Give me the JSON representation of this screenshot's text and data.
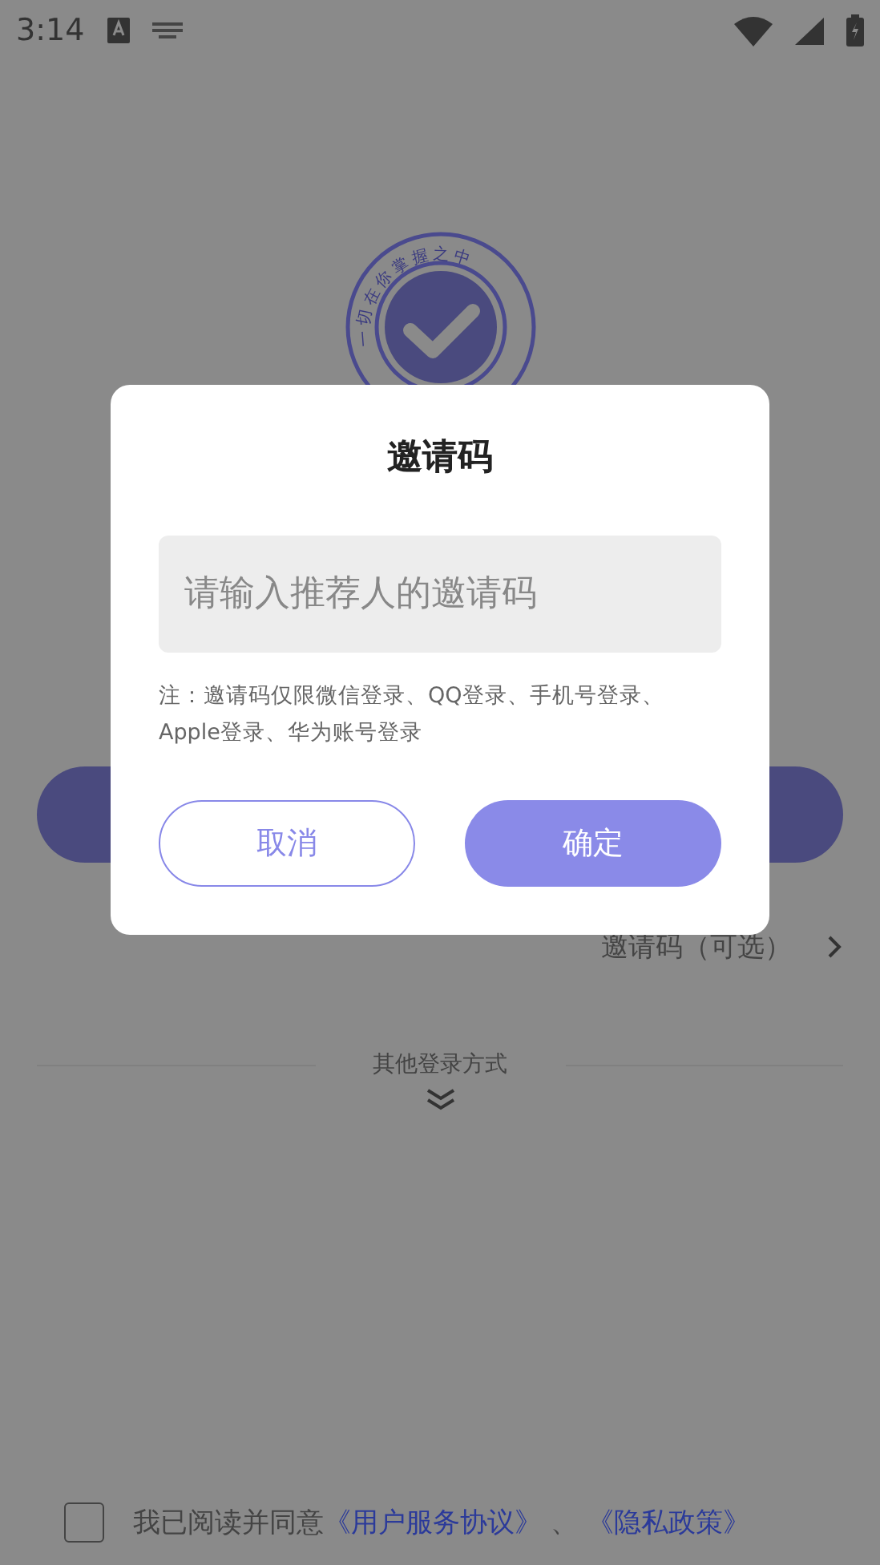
{
  "status_bar": {
    "time": "3:14"
  },
  "logo": {
    "ring_text": "一切在你掌握之中"
  },
  "invite_row": {
    "label": "邀请码（可选）"
  },
  "other_login": {
    "label": "其他登录方式"
  },
  "agreement": {
    "checked": false,
    "text": "我已阅读并同意",
    "links": [
      "《用户服务协议》",
      "《隐私政策》"
    ],
    "separator": "、"
  },
  "dialog": {
    "title": "邀请码",
    "input": {
      "placeholder": "请输入推荐人的邀请码"
    },
    "note": "注：邀请码仅限微信登录、QQ登录、手机号登录、Apple登录、华为账号登录",
    "buttons": [
      {
        "label": "取消",
        "kind": "outline"
      },
      {
        "label": "确定",
        "kind": "filled"
      }
    ]
  }
}
